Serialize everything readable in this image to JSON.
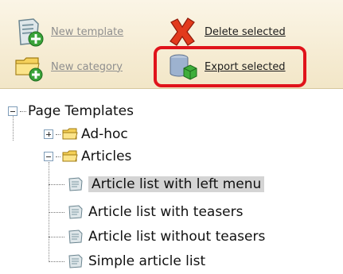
{
  "toolbar": {
    "new_template": "New template",
    "delete_selected": "Delete selected",
    "new_category": "New category",
    "export_selected": "Export selected"
  },
  "tree": {
    "root": "Page Templates",
    "adhoc": "Ad-hoc",
    "articles": "Articles",
    "children": [
      "Article list with left menu",
      "Article list with teasers",
      "Article list without teasers",
      "Simple article list"
    ]
  }
}
